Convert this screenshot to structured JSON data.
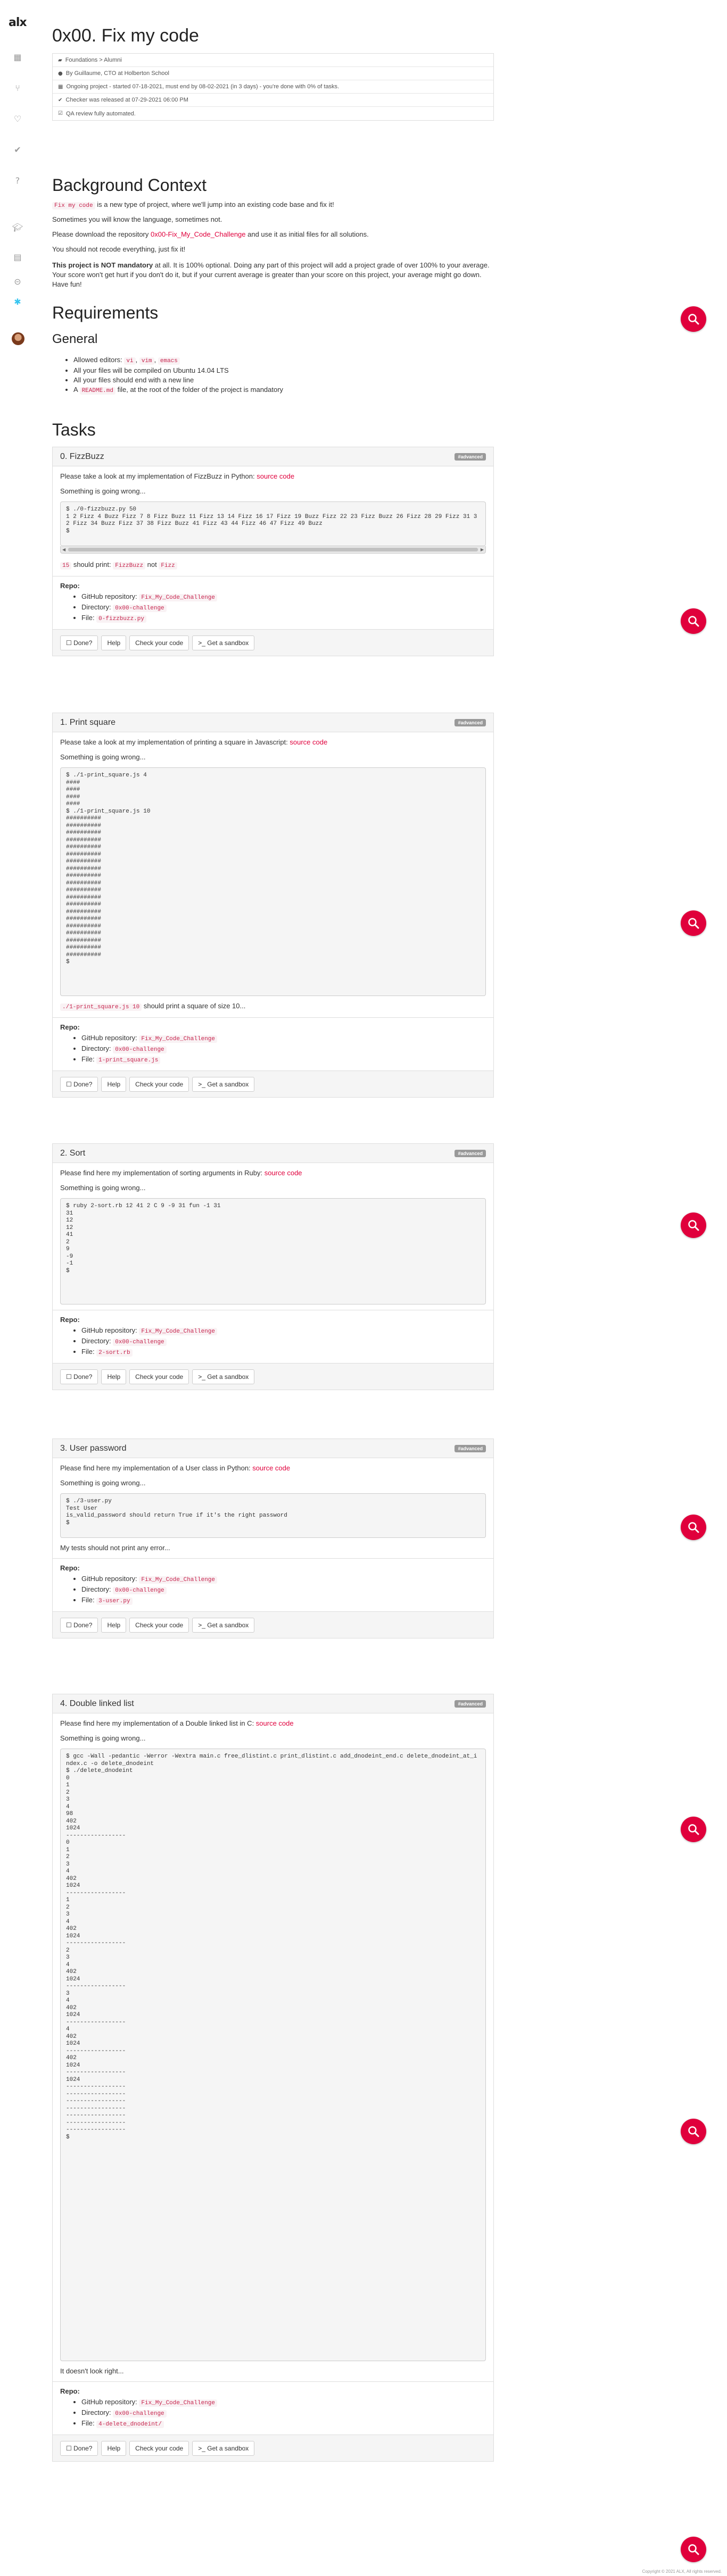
{
  "brand": {
    "logo": "alx",
    "accent": "#e0003c"
  },
  "sidebar": {
    "icons": [
      "calendar-icon",
      "git-branch-icon",
      "thumbs-up-icon",
      "check-icon",
      "question-icon",
      "graduation-cap-icon",
      "document-icon",
      "toggle-icon",
      "slack-icon"
    ]
  },
  "page": {
    "title": "0x00. Fix my code",
    "meta": [
      "Foundations > Alumni",
      "By Guillaume, CTO at Holberton School",
      "Ongoing project - started 07-18-2021, must end by 08-02-2021 (in 3 days) - you're done with 0% of tasks.",
      "Checker was released at 07-29-2021 06:00 PM",
      "QA review fully automated."
    ]
  },
  "context": {
    "heading": "Background Context",
    "p1_code": "Fix my code",
    "p1_text": " is a new type of project, where we'll jump into an existing code base and fix it!",
    "p2": "Sometimes you will know the language, sometimes not.",
    "p3_before": "Please download the repository ",
    "p3_link": "0x00-Fix_My_Code_Challenge",
    "p3_after": " and use it as initial files for all solutions.",
    "p4": "You should not recode everything, just fix it!",
    "p5_bold": "This project is NOT mandatory",
    "p5_text": " at all. It is 100% optional. Doing any part of this project will add a project grade of over 100% to your average. Your score won't get hurt if you don't do it, but if your current average is greater than your score on this project, your average might go down. Have fun!"
  },
  "requirements": {
    "heading": "Requirements",
    "general": "General",
    "items": [
      {
        "pre": "Allowed editors: ",
        "codes": [
          "vi",
          "vim",
          "emacs"
        ]
      },
      {
        "pre": "All your files will be compiled on Ubuntu 14.04 LTS"
      },
      {
        "pre": "All your files should end with a new line"
      },
      {
        "pre": "A ",
        "codes": [
          "README.md"
        ],
        "post": " file, at the root of the folder of the project is mandatory"
      }
    ]
  },
  "tasks_heading": "Tasks",
  "common": {
    "badge": "#advanced",
    "source_link": "source code",
    "repo_label": "Repo:",
    "gh_label": "GitHub repository: ",
    "gh_value": "Fix_My_Code_Challenge",
    "dir_label": "Directory: ",
    "dir_value": "0x00-challenge",
    "file_label": "File: ",
    "buttons": {
      "done": "Done?",
      "help": "Help",
      "check": "Check your code",
      "sandbox": "Get a sandbox"
    },
    "wrong": "Something is going wrong..."
  },
  "tasks": [
    {
      "title": "0. FizzBuzz",
      "intro": "Please take a look at my implementation of FizzBuzz in Python: ",
      "terminal": "$ ./0-fizzbuzz.py 50\n1 2 Fizz 4 Buzz Fizz 7 8 Fizz Buzz 11 Fizz 13 14 Fizz 16 17 Fizz 19 Buzz Fizz 22 23 Fizz Buzz 26 Fizz 28 29 Fizz 31 32 Fizz 34 Buzz Fizz 37 38 Fizz Buzz 41 Fizz 43 44 Fizz 46 47 Fizz 49 Buzz\n$",
      "note_code1": "15",
      "note_mid": " should print: ",
      "note_code2": "FizzBuzz",
      "note_not": " not ",
      "note_code3": "Fizz",
      "file": "0-fizzbuzz.py"
    },
    {
      "title": "1. Print square",
      "intro": "Please take a look at my implementation of printing a square in Javascript: ",
      "terminal": "$ ./1-print_square.js 4\n####\n####\n####\n####\n$ ./1-print_square.js 10\n##########\n##########\n##########\n##########\n##########\n##########\n##########\n##########\n##########\n##########\n##########\n##########\n##########\n##########\n##########\n##########\n##########\n##########\n##########\n##########\n$",
      "note_code1": "./1-print_square.js 10",
      "note_mid": " should print a square of size 10...",
      "file": "1-print_square.js"
    },
    {
      "title": "2. Sort",
      "intro": "Please find here my implementation of sorting arguments in Ruby: ",
      "terminal": "$ ruby 2-sort.rb 12 41 2 C 9 -9 31 fun -1 31\n31\n12\n12\n41\n2\n9\n-9\n-1\n$",
      "file": "2-sort.rb"
    },
    {
      "title": "3. User password",
      "intro": "Please find here my implementation of a User class in Python: ",
      "terminal": "$ ./3-user.py\nTest User\nis_valid_password should return True if it's the right password\n$",
      "note_plain": "My tests should not print any error...",
      "file": "3-user.py"
    },
    {
      "title": "4. Double linked list",
      "intro": "Please find here my implementation of a Double linked list in C: ",
      "terminal": "$ gcc -Wall -pedantic -Werror -Wextra main.c free_dlistint.c print_dlistint.c add_dnodeint_end.c delete_dnodeint_at_index.c -o delete_dnodeint\n$ ./delete_dnodeint\n0\n1\n2\n3\n4\n98\n402\n1024\n-----------------\n0\n1\n2\n3\n4\n402\n1024\n-----------------\n1\n2\n3\n4\n402\n1024\n-----------------\n2\n3\n4\n402\n1024\n-----------------\n3\n4\n402\n1024\n-----------------\n4\n402\n1024\n-----------------\n402\n1024\n-----------------\n1024\n-----------------\n-----------------\n-----------------\n-----------------\n-----------------\n-----------------\n-----------------\n$",
      "note_plain": "It doesn't look right...",
      "file": "4-delete_dnodeint/"
    }
  ],
  "footer": "Copyright © 2021 ALX, All rights reserved."
}
